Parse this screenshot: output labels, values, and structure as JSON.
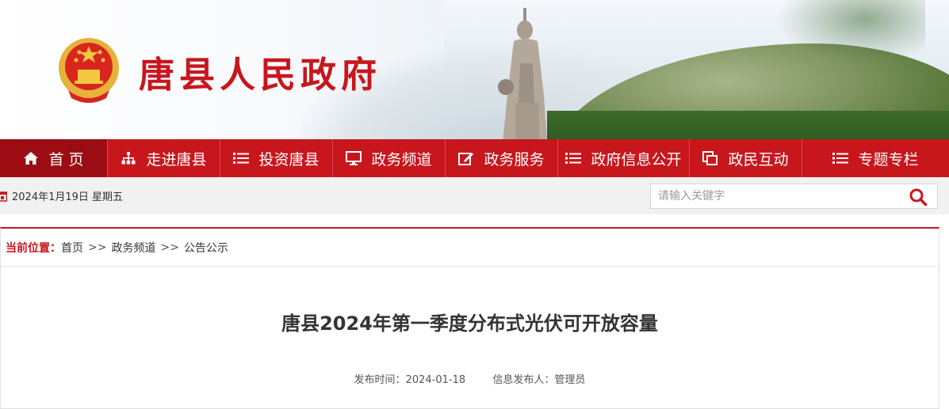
{
  "header": {
    "site_title": "唐县人民政府",
    "emblem_icon": "national-emblem-icon"
  },
  "nav": {
    "items": [
      {
        "label": "首 页",
        "icon": "home-icon"
      },
      {
        "label": "走进唐县",
        "icon": "org-chart-icon"
      },
      {
        "label": "投资唐县",
        "icon": "list-icon"
      },
      {
        "label": "政务频道",
        "icon": "monitor-icon"
      },
      {
        "label": "政务服务",
        "icon": "edit-icon"
      },
      {
        "label": "政府信息公开",
        "icon": "list-icon"
      },
      {
        "label": "政民互动",
        "icon": "copy-icon"
      },
      {
        "label": "专题专栏",
        "icon": "list-icon"
      }
    ]
  },
  "infobar": {
    "date_text": "2024年1月19日 星期五",
    "search_placeholder": "请输入关键字"
  },
  "breadcrumb": {
    "label": "当前位置：",
    "items": [
      "首页",
      "政务频道",
      "公告公示"
    ],
    "separator": ">>"
  },
  "article": {
    "title": "唐县2024年第一季度分布式光伏可开放容量",
    "publish_label": "发布时间：",
    "publish_date": "2024-01-18",
    "publisher_label": "信息发布人：",
    "publisher": "管理员"
  },
  "colors": {
    "brand_red": "#c8161d",
    "nav_home_bg": "#9b0d13",
    "infobar_bg": "#f1f1f1"
  }
}
